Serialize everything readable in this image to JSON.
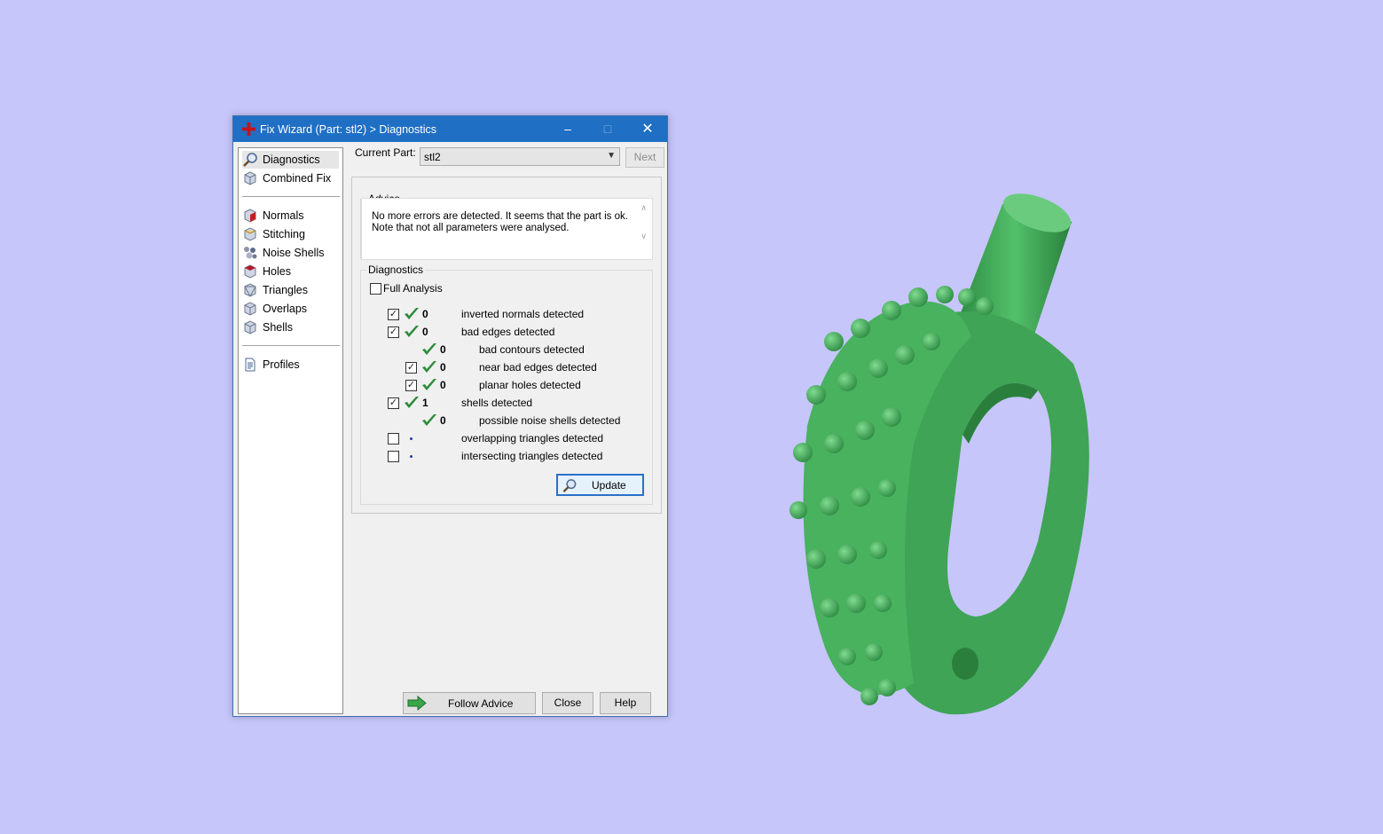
{
  "window": {
    "title": "Fix Wizard (Part: stl2) > Diagnostics",
    "minimize": "–",
    "maximize": "□",
    "close": "✕"
  },
  "sidebar": {
    "items": [
      {
        "label": "Diagnostics",
        "icon": "magnifier-icon",
        "active": true
      },
      {
        "label": "Combined Fix",
        "icon": "cube-icon"
      },
      {
        "label": "Normals",
        "icon": "normals-cube-icon"
      },
      {
        "label": "Stitching",
        "icon": "stitching-cube-icon"
      },
      {
        "label": "Noise Shells",
        "icon": "noise-shells-icon"
      },
      {
        "label": "Holes",
        "icon": "holes-cube-icon"
      },
      {
        "label": "Triangles",
        "icon": "triangles-cube-icon"
      },
      {
        "label": "Overlaps",
        "icon": "overlaps-cube-icon"
      },
      {
        "label": "Shells",
        "icon": "shells-cube-icon"
      },
      {
        "label": "Profiles",
        "icon": "document-icon"
      }
    ]
  },
  "header": {
    "current_part_label": "Current Part:",
    "current_part_value": "stl2",
    "next_label": "Next"
  },
  "advice": {
    "title": "Advice",
    "text": "No more errors are detected. It seems that the part is ok. Note that not all parameters were analysed."
  },
  "diagnostics": {
    "title": "Diagnostics",
    "full_analysis_label": "Full Analysis",
    "rows": [
      {
        "checked": true,
        "status": "ok",
        "count": "0",
        "label": "inverted normals detected"
      },
      {
        "checked": true,
        "status": "ok",
        "count": "0",
        "label": "bad edges detected"
      },
      {
        "checked": null,
        "status": "ok",
        "count": "0",
        "label": "bad contours detected"
      },
      {
        "checked": true,
        "status": "ok",
        "count": "0",
        "label": "near bad edges detected"
      },
      {
        "checked": true,
        "status": "ok",
        "count": "0",
        "label": "planar holes detected"
      },
      {
        "checked": true,
        "status": "ok",
        "count": "1",
        "label": "shells detected"
      },
      {
        "checked": null,
        "status": "ok",
        "count": "0",
        "label": "possible noise shells detected"
      },
      {
        "checked": false,
        "status": "not-run",
        "count": "",
        "label": "overlapping triangles detected"
      },
      {
        "checked": false,
        "status": "not-run",
        "count": "",
        "label": "intersecting triangles detected"
      }
    ],
    "update_label": "Update"
  },
  "footer": {
    "follow_advice_label": "Follow Advice",
    "close_label": "Close",
    "help_label": "Help"
  },
  "colors": {
    "background": "#c6c6fb",
    "titlebar": "#1f6fc4",
    "check_green": "#2e8b3a",
    "model_green": "#3fae5a"
  }
}
